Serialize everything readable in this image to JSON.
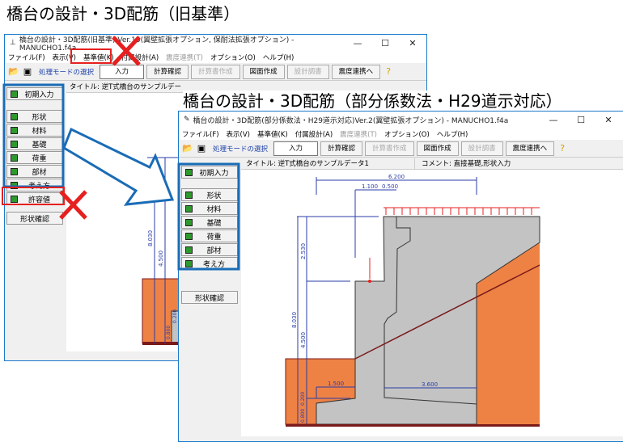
{
  "headings": {
    "old": "橋台の設計・3D配筋（旧基準）",
    "new": "橋台の設計・3D配筋（部分係数法・H29道示対応）"
  },
  "old_window": {
    "title": "橋台の設計・3D配筋(旧基準) Ver.15(翼壁拡張オプション, 保耐法拡張オプション) - MANUCHO1.f4a",
    "menu": [
      "ファイル(F)",
      "表示(V)",
      "基準値(K)",
      "付属設計(A)",
      "震度連携(T)",
      "オプション(O)",
      "ヘルプ(H)"
    ],
    "toolbar": {
      "mode_label": "処理モードの選択",
      "buttons": [
        "入力",
        "計算確認",
        "計算書作成",
        "図面作成",
        "設計調書",
        "震度連携へ"
      ]
    },
    "info_title": "タイトル: 逆T式橋台のサンプルデー",
    "sidebar": [
      "初期入力",
      "形状",
      "材料",
      "基礎",
      "荷重",
      "部材",
      "考え方",
      "許容値"
    ],
    "shape_check": "形状確認",
    "dims": [
      "8.030",
      "4.500",
      "0.800",
      "0.200"
    ]
  },
  "new_window": {
    "title": "橋台の設計・3D配筋(部分係数法・H29道示対応)Ver.2(翼壁拡張オプション) - MANUCHO1.f4a",
    "menu": [
      "ファイル(F)",
      "表示(V)",
      "基準値(K)",
      "付属設計(A)",
      "震度連携(T)",
      "オプション(O)",
      "ヘルプ(H)"
    ],
    "toolbar": {
      "mode_label": "処理モードの選択",
      "buttons": [
        "入力",
        "計算確認",
        "計算書作成",
        "図面作成",
        "設計調書",
        "震度連携へ"
      ]
    },
    "info_title": "タイトル: 逆T式橋台のサンプルデータ1",
    "info_comment": "コメント: 直接基礎,形状入力",
    "sidebar": [
      "初期入力",
      "形状",
      "材料",
      "基礎",
      "荷重",
      "部材",
      "考え方"
    ],
    "shape_check": "形状確認",
    "dims": {
      "total_width": "6.200",
      "d1": "1.100",
      "d2": "0.500",
      "h_upper": "2.530",
      "h_total": "8.030",
      "h_wall": "4.500",
      "toe": "1.500",
      "heel": "3.600",
      "base1": "0.800",
      "base2": "0.200"
    }
  },
  "window_controls": {
    "min": "—",
    "max": "☐",
    "close": "✕"
  },
  "colors": {
    "soil": "#ee8244",
    "concrete": "#c3c3c3",
    "dim": "#2a3ca8",
    "accent_blue": "#1a6cb6",
    "red": "#e6201f"
  }
}
